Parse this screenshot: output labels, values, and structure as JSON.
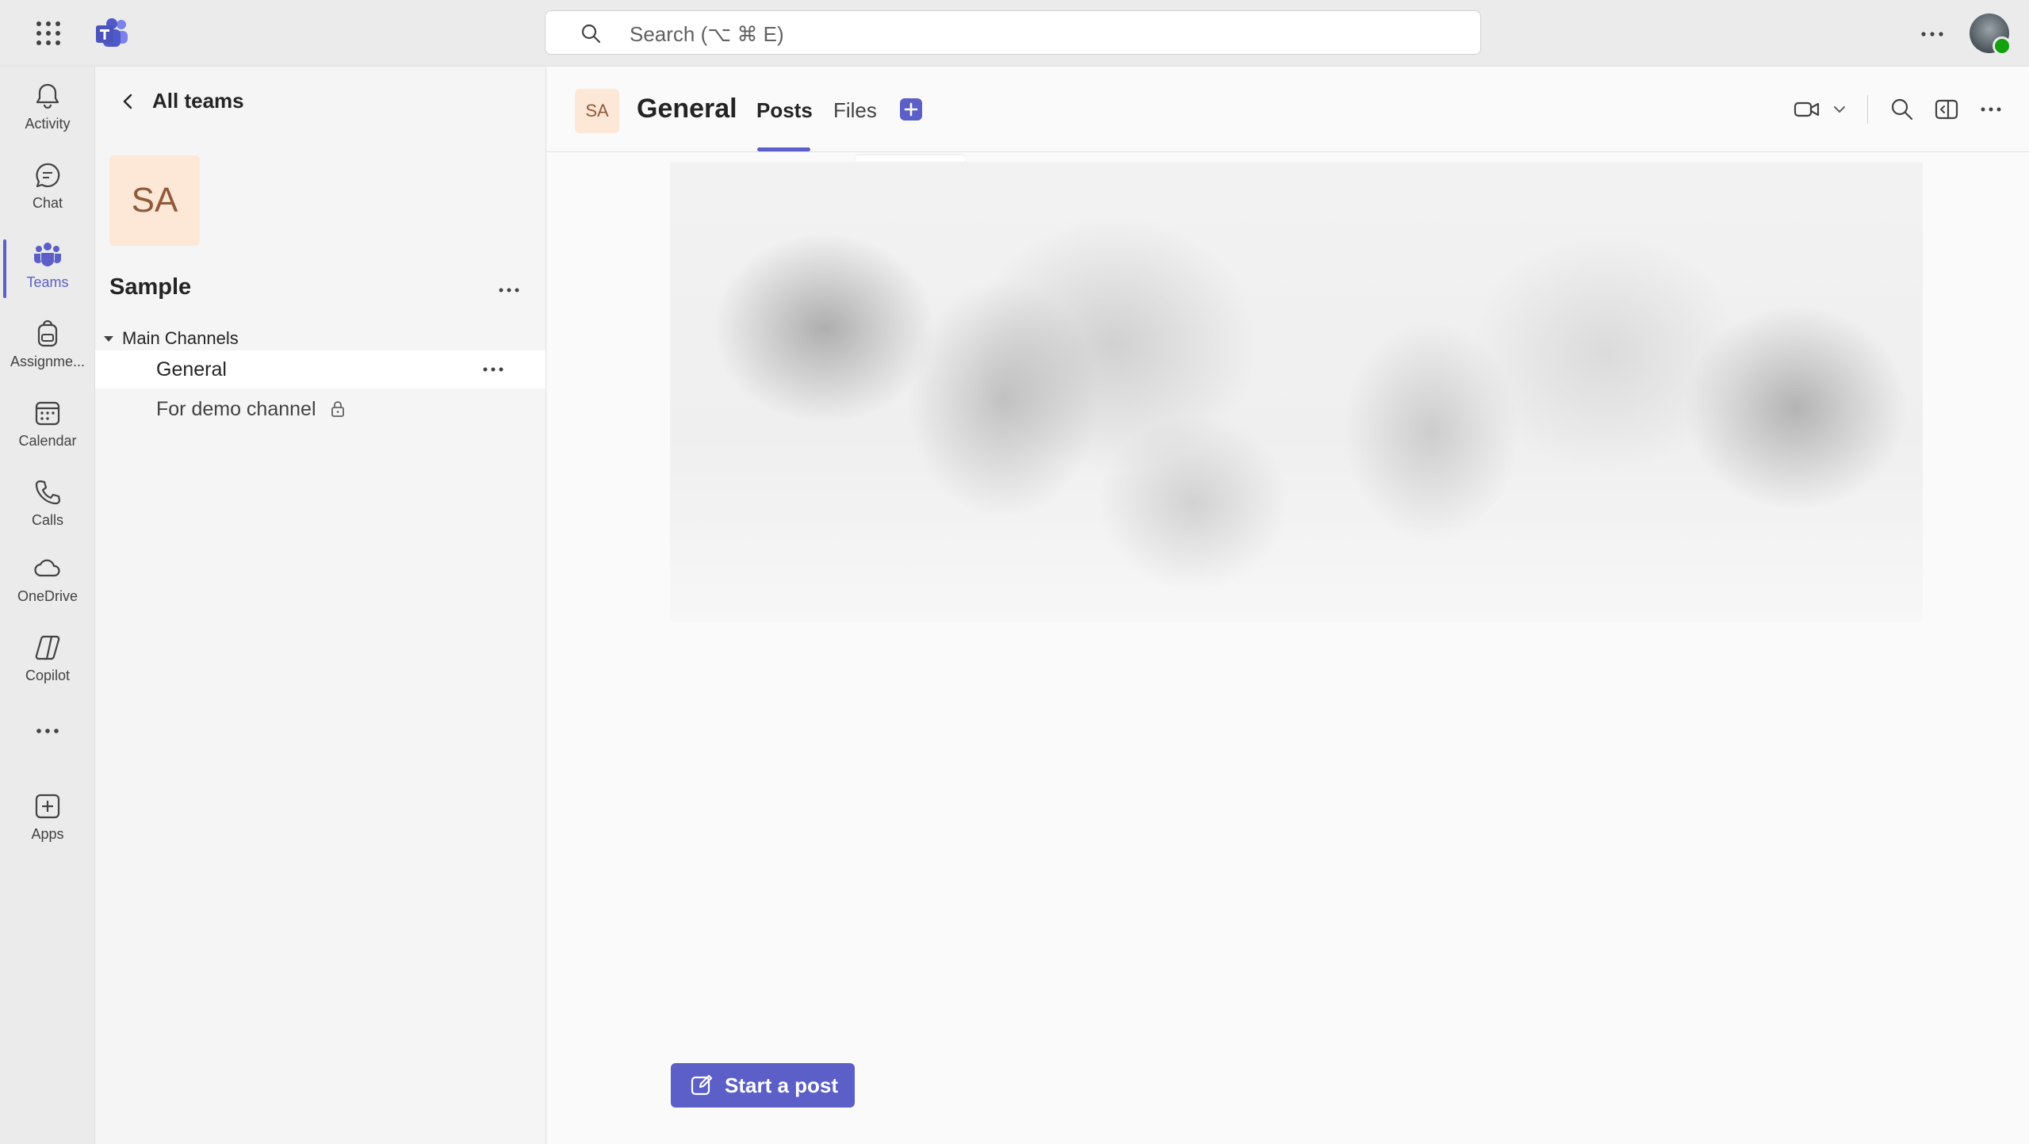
{
  "colors": {
    "accent": "#5b5fc7",
    "presence": "#13a10e",
    "team_avatar_bg": "#fde7d7"
  },
  "topbar": {
    "search_placeholder": "Search (⌥ ⌘ E)",
    "icons": [
      "app-launcher-icon",
      "teams-logo-icon",
      "search-icon",
      "more-icon"
    ]
  },
  "rail": {
    "items": [
      {
        "label": "Activity",
        "icon": "bell-icon"
      },
      {
        "label": "Chat",
        "icon": "chat-icon"
      },
      {
        "label": "Teams",
        "icon": "teams-icon",
        "active": true
      },
      {
        "label": "Assignme...",
        "icon": "backpack-icon"
      },
      {
        "label": "Calendar",
        "icon": "calendar-icon"
      },
      {
        "label": "Calls",
        "icon": "phone-icon"
      },
      {
        "label": "OneDrive",
        "icon": "cloud-icon"
      },
      {
        "label": "Copilot",
        "icon": "copilot-icon"
      },
      {
        "label": "Apps",
        "icon": "add-app-icon"
      }
    ]
  },
  "team_panel": {
    "back_label": "All teams",
    "team_initials": "SA",
    "team_name": "Sample",
    "section_label": "Main Channels",
    "channels": [
      {
        "name": "General",
        "selected": true
      },
      {
        "name": "For demo channel",
        "private": true
      }
    ]
  },
  "channel_header": {
    "initials": "SA",
    "title": "General",
    "tabs": [
      {
        "label": "Posts",
        "active": true
      },
      {
        "label": "Files"
      }
    ]
  },
  "composer": {
    "start_post_label": "Start a post"
  }
}
